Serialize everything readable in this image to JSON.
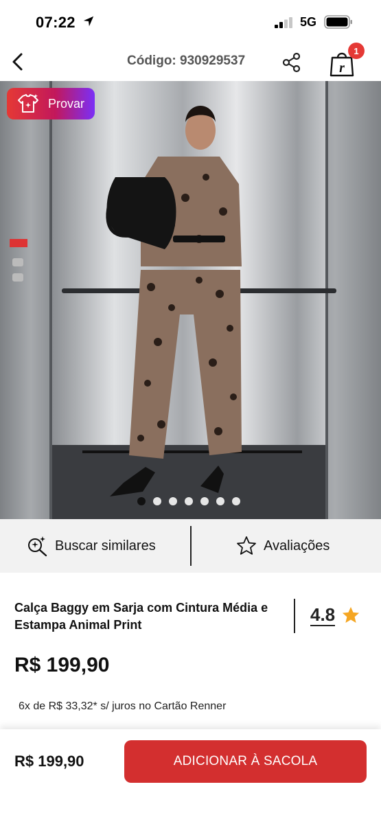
{
  "status_bar": {
    "time": "07:22",
    "network": "5G"
  },
  "nav": {
    "code_label": "Código: 930929537",
    "cart_count": "1",
    "back_icon": "chevron-left-icon",
    "share_icon": "share-icon",
    "bag_icon": "shopping-bag-icon"
  },
  "hero": {
    "try_on_label": "Provar",
    "carousel": {
      "total": 7,
      "active_index": 0
    }
  },
  "actions": {
    "similar_label": "Buscar similares",
    "reviews_label": "Avaliações"
  },
  "product": {
    "title": "Calça Baggy em Sarja com Cintura Média e Estampa Animal Print",
    "rating": "4.8",
    "price": "R$ 199,90",
    "installments": "6x de R$ 33,32* s/ juros no Cartão Renner"
  },
  "bottom_bar": {
    "price": "R$ 199,90",
    "add_to_bag_label": "ADICIONAR À SACOLA"
  },
  "colors": {
    "brand_red": "#d32f2f",
    "badge_red": "#e53935",
    "try_gradient_start": "#e53935",
    "try_gradient_end": "#7b2ff7",
    "star": "#f5a623"
  }
}
